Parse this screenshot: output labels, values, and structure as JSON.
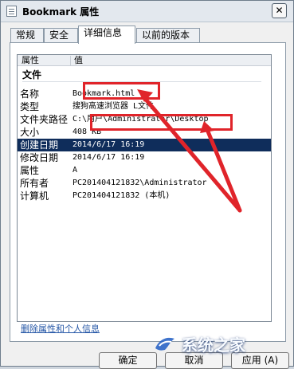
{
  "window": {
    "title": "Bookmark 属性",
    "close_label": "✕"
  },
  "tabs": [
    {
      "label": "常规"
    },
    {
      "label": "安全"
    },
    {
      "label": "详细信息"
    },
    {
      "label": "以前的版本"
    }
  ],
  "details": {
    "headers": {
      "property": "属性",
      "value": "值"
    },
    "group": "文件",
    "rows": [
      {
        "name": "名称",
        "value": "Bookmark.html"
      },
      {
        "name": "类型",
        "value": "搜狗高速浏览器 L文件"
      },
      {
        "name": "文件夹路径",
        "value": "C:\\用户\\Administrator\\Desktop"
      },
      {
        "name": "大小",
        "value": "408 KB"
      },
      {
        "name": "创建日期",
        "value": "2014/6/17 16:19"
      },
      {
        "name": "修改日期",
        "value": "2014/6/17 16:19"
      },
      {
        "name": "属性",
        "value": "A"
      },
      {
        "name": "所有者",
        "value": "PC201404121832\\Administrator"
      },
      {
        "name": "计算机",
        "value": "PC201404121832 (本机)"
      }
    ]
  },
  "footer": {
    "remove_link": "删除属性和个人信息",
    "buttons": [
      {
        "label": "确定"
      },
      {
        "label": "取消"
      },
      {
        "label": "应用 (A)"
      }
    ]
  },
  "watermark": {
    "text": "系统之家"
  },
  "colors": {
    "selection": "#0f2d5b",
    "annotation_red": "#e0242a",
    "link": "#2456a6"
  }
}
